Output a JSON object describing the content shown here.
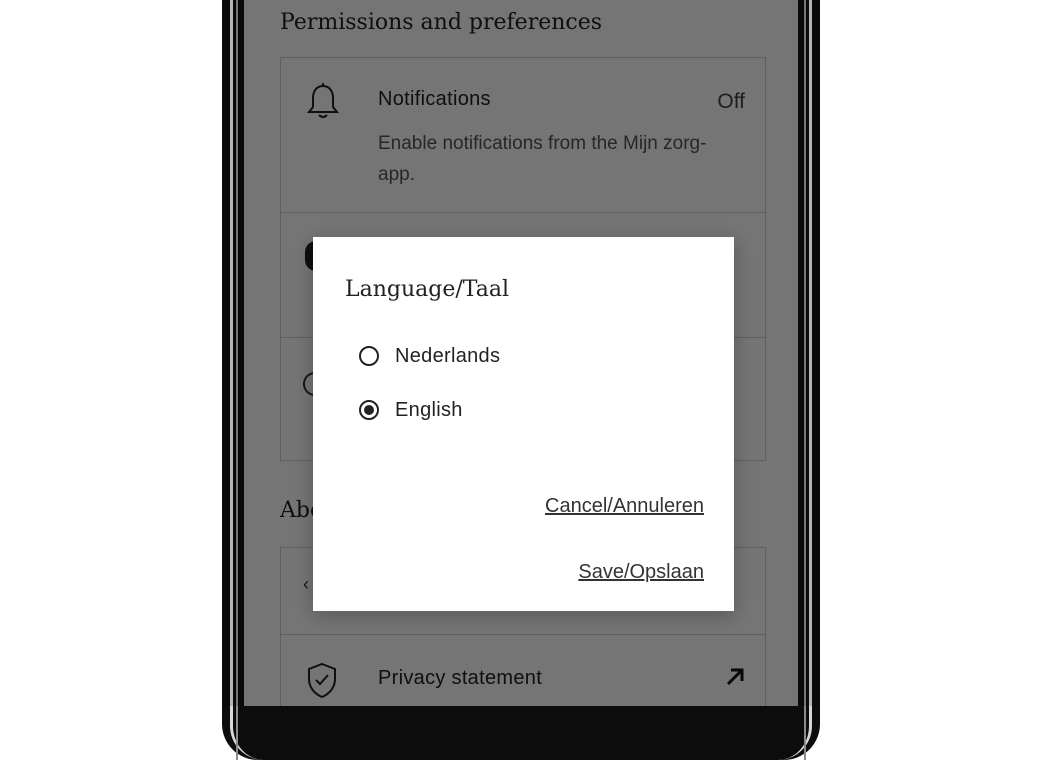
{
  "screen": {
    "permissions_section_title": "Permissions and preferences",
    "about_section_title": "Abo",
    "notifications": {
      "icon": "bell-icon",
      "title": "Notifications",
      "value": "Off",
      "description": "Enable notifications from the Mijn zorg-app."
    },
    "privacy": {
      "icon": "shield-check-icon",
      "title": "Privacy statement",
      "action_icon": "external-arrow-icon"
    }
  },
  "dialog": {
    "title": "Language/Taal",
    "options": [
      {
        "label": "Nederlands",
        "selected": false
      },
      {
        "label": "English",
        "selected": true
      }
    ],
    "cancel_label": "Cancel/Annuleren",
    "save_label": "Save/Opslaan"
  },
  "colors": {
    "scrim": "#000000",
    "text": "#222222",
    "dialog_bg": "#ffffff"
  }
}
